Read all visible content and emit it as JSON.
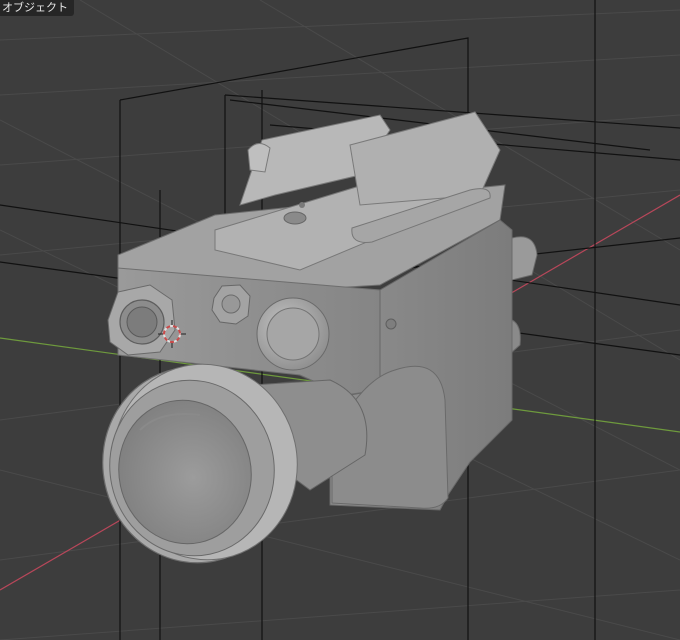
{
  "viewport": {
    "mode_label": "オブジェクト",
    "colors": {
      "background": "#3d3d3d",
      "grid": "#4a4a4a",
      "axis_x": "#b8475a",
      "axis_y": "#6e9a3d",
      "mesh_light": "#bdbdbd",
      "mesh_mid": "#a0a0a0",
      "mesh_dark": "#7a7a7a",
      "wire": "#111111"
    },
    "icons": [
      "3d-cursor-icon"
    ]
  }
}
